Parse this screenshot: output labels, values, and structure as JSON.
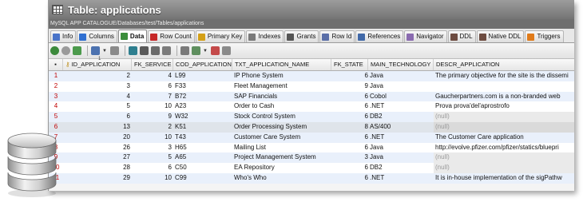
{
  "window": {
    "title": "Table: applications",
    "path": "MySQL APP CATALOGUE/Databases/test/Tables/applications"
  },
  "tabs": [
    {
      "label": "Info",
      "color": "#4a74c9",
      "active": false
    },
    {
      "label": "Columns",
      "color": "#2f6fd1",
      "active": false
    },
    {
      "label": "Data",
      "color": "#3b8d3b",
      "active": true
    },
    {
      "label": "Row Count",
      "color": "#c62828",
      "active": false
    },
    {
      "label": "Primary Key",
      "color": "#d4a017",
      "active": false
    },
    {
      "label": "Indexes",
      "color": "#7a7a7a",
      "active": false
    },
    {
      "label": "Grants",
      "color": "#555555",
      "active": false
    },
    {
      "label": "Row Id",
      "color": "#5b6fa8",
      "active": false
    },
    {
      "label": "References",
      "color": "#4169a8",
      "active": false
    },
    {
      "label": "Navigator",
      "color": "#8a6bb0",
      "active": false
    },
    {
      "label": "DDL",
      "color": "#6d4c41",
      "active": false
    },
    {
      "label": "Native DDL",
      "color": "#6d4c41",
      "active": false
    },
    {
      "label": "Triggers",
      "color": "#e07b1a",
      "active": false
    }
  ],
  "toolbar_icons": [
    "refresh-icon",
    "stop-icon",
    "filter-icon",
    "dropdown-caret",
    "copy-icon",
    "grid-icon",
    "save-icon",
    "export-icon",
    "pin-icon",
    "link-icon",
    "dropdown-caret",
    "bookmark-icon",
    "arrow-icon"
  ],
  "grid": {
    "columns": [
      "ID_APPLICATION",
      "FK_SERVICE",
      "COD_APPLICATION",
      "TXT_APPLICATION_NAME",
      "FK_STATE",
      "MAIN_TECHNOLOGY",
      "DESCR_APPLICATION"
    ],
    "sort_indicator": "1",
    "rows": [
      {
        "rn": "1",
        "id": "2",
        "svc": "4",
        "cod": "L99",
        "name": "IP Phone System",
        "state": "6",
        "tech": "Java",
        "descr": "The primary objective for the site is the dissemi",
        "descr_null": false
      },
      {
        "rn": "2",
        "id": "3",
        "svc": "6",
        "cod": "F33",
        "name": "Fleet Management",
        "state": "9",
        "tech": "Java",
        "descr": "",
        "descr_null": false
      },
      {
        "rn": "3",
        "id": "4",
        "svc": "7",
        "cod": "B72",
        "name": "SAP Financials",
        "state": "6",
        "tech": "Cobol",
        "descr": "Gaucherpartners.com is a non-branded web",
        "descr_null": false
      },
      {
        "rn": "4",
        "id": "5",
        "svc": "10",
        "cod": "A23",
        "name": "Order to Cash",
        "state": "6",
        "tech": ".NET",
        "descr": "Prova prova'del'aprostrofo",
        "descr_null": false
      },
      {
        "rn": "5",
        "id": "6",
        "svc": "9",
        "cod": "W32",
        "name": "Stock Control System",
        "state": "6",
        "tech": "DB2",
        "descr": "(null)",
        "descr_null": true
      },
      {
        "rn": "6",
        "id": "13",
        "svc": "2",
        "cod": "K51",
        "name": "Order Processing System",
        "state": "8",
        "tech": "AS/400",
        "descr": "(null)",
        "descr_null": true
      },
      {
        "rn": "7",
        "id": "20",
        "svc": "10",
        "cod": "T43",
        "name": "Customer Care System",
        "state": "6",
        "tech": ".NET",
        "descr": "The Customer Care application",
        "descr_null": false
      },
      {
        "rn": "8",
        "id": "26",
        "svc": "3",
        "cod": "H65",
        "name": "Mailing List",
        "state": "6",
        "tech": "Java",
        "descr": "http://evolve.pfizer.com/pfizer/statics/bluepri",
        "descr_null": false
      },
      {
        "rn": "9",
        "id": "27",
        "svc": "5",
        "cod": "A65",
        "name": "Project Management System",
        "state": "3",
        "tech": "Java",
        "descr": "(null)",
        "descr_null": true
      },
      {
        "rn": "10",
        "id": "28",
        "svc": "6",
        "cod": "C50",
        "name": "EA Repository",
        "state": "6",
        "tech": "DB2",
        "descr": "(null)",
        "descr_null": true
      },
      {
        "rn": "11",
        "id": "29",
        "svc": "10",
        "cod": "C99",
        "name": "Who's Who",
        "state": "6",
        "tech": ".NET",
        "descr": "It is in-house implementation of the sigPathw",
        "descr_null": false
      }
    ]
  },
  "selected_row": "6",
  "logo": "database-icon"
}
